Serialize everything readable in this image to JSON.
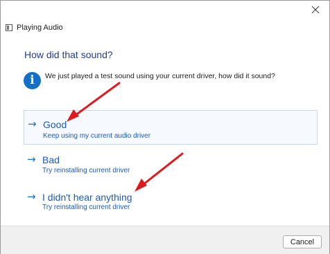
{
  "window": {
    "title": "Playing Audio"
  },
  "heading": "How did that sound?",
  "info": {
    "icon": "info-icon",
    "text": "We just played a test sound using your current driver, how did it sound?"
  },
  "options": [
    {
      "title": "Good",
      "subtitle": "Keep using my current audio driver",
      "selected": true
    },
    {
      "title": "Bad",
      "subtitle": "Try reinstalling current driver",
      "selected": false
    },
    {
      "title": "I didn't hear anything",
      "subtitle": "Try reinstalling current driver",
      "selected": false
    }
  ],
  "buttons": {
    "cancel": "Cancel"
  },
  "annotations": {
    "arrow_color": "#e0191f",
    "count": 3
  },
  "colors": {
    "accent": "#1570c6",
    "heading": "#1e3e8c"
  }
}
